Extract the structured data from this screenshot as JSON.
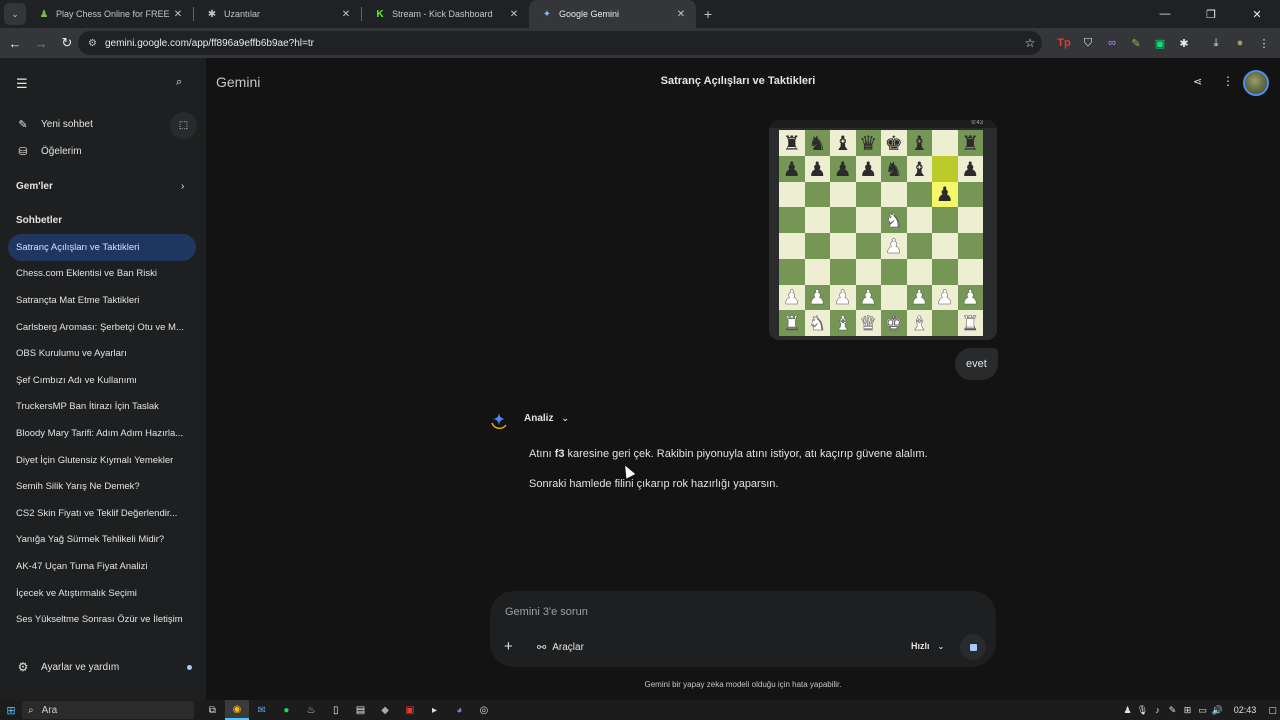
{
  "browser": {
    "tabs": [
      {
        "title": "Play Chess Online for FREE - 2 Play",
        "icon": "chess-pawn-icon",
        "icon_color": "#81b64c",
        "active": false
      },
      {
        "title": "Uzantılar",
        "icon": "puzzle-icon",
        "icon_color": "#c4c7c5",
        "active": false
      },
      {
        "title": "Stream - Kick Dashboard",
        "icon": "kick-icon",
        "icon_color": "#53fc18",
        "active": false
      },
      {
        "title": "Google Gemini",
        "icon": "gemini-icon",
        "icon_color": "#8ab4f8",
        "active": true
      }
    ],
    "url": "gemini.google.com/app/ff896a9effb6b9ae?hl=tr"
  },
  "sidebar": {
    "new_chat": "Yeni sohbet",
    "my_stuff": "Öğelerim",
    "gems_header": "Gem'ler",
    "chats_header": "Sohbetler",
    "chats": [
      "Satranç Açılışları ve Taktikleri",
      "Chess.com Eklentisi ve Ban Riski",
      "Satrançta Mat Etme Taktikleri",
      "Carlsberg Aroması: Şerbetçi Otu ve M...",
      "OBS Kurulumu ve Ayarları",
      "Şef Cımbızı Adı ve Kullanımı",
      "TruckersMP Ban İtirazı İçin Taslak",
      "Bloody Mary Tarifi: Adım Adım Hazırla...",
      "Diyet İçin Glutensiz Kıymalı Yemekler",
      "Semih Silik Yarış Ne Demek?",
      "CS2 Skin Fiyatı ve Teklif Değerlendir...",
      "Yanığa Yağ Sürmek Tehlikeli Midir?",
      "AK-47 Uçan Turna Fiyat Analizi",
      "İçecek ve Atıştırmalık Seçimi",
      "Ses Yükseltme Sonrası Özür ve İletişim"
    ],
    "settings": "Ayarlar ve yardım"
  },
  "header": {
    "brand": "Gemini",
    "title": "Satranç Açılışları ve Taktikleri"
  },
  "chess_board": {
    "clock": "9:43",
    "ranks": [
      [
        "r",
        "n",
        "b",
        "q",
        "k",
        "b",
        "",
        "r"
      ],
      [
        "p",
        "p",
        "p",
        "p",
        "n",
        "b",
        "",
        "p"
      ],
      [
        "",
        "",
        "",
        "",
        "",
        "",
        "p",
        ""
      ],
      [
        "",
        "",
        "",
        "",
        "N",
        "",
        "",
        ""
      ],
      [
        "",
        "",
        "",
        "",
        "P",
        "",
        "",
        ""
      ],
      [
        "",
        "",
        "",
        "",
        "",
        "",
        "",
        ""
      ],
      [
        "P",
        "P",
        "P",
        "P",
        "",
        "P",
        "P",
        "P"
      ],
      [
        "R",
        "N",
        "B",
        "Q",
        "K",
        "B",
        "",
        "R"
      ]
    ],
    "highlight": [
      "g7",
      "g6"
    ]
  },
  "user_message": "evet",
  "model": {
    "label": "Analiz",
    "reply_p1_before": "Atını ",
    "reply_p1_bold": "f3",
    "reply_p1_after": " karesine geri çek. Rakibin piyonuyla atını istiyor, atı kaçırıp güvene alalım.",
    "reply_p2": "Sonraki hamlede filini çıkarıp rok hazırlığı yaparsın."
  },
  "composer": {
    "placeholder": "Gemini 3'e sorun",
    "tools": "Araçlar",
    "mode": "Hızlı"
  },
  "disclaimer": "Gemini bir yapay zeka modeli olduğu için hata yapabilir.",
  "taskbar": {
    "search": "Ara",
    "time": "02:43"
  },
  "colors": {
    "accent": "#a8c7fa",
    "active_chat_bg": "#1f3760",
    "board_light": "#eeeed2",
    "board_dark": "#769656"
  }
}
